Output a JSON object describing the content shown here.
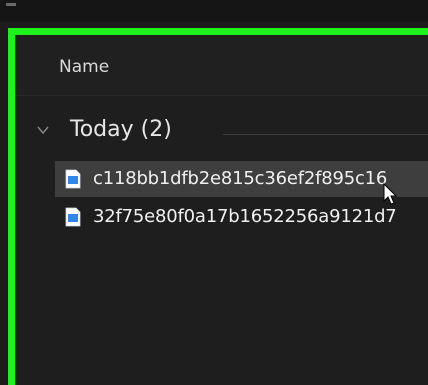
{
  "header": {
    "name_column": "Name"
  },
  "group": {
    "label": "Today (2)"
  },
  "files": [
    {
      "name": "c118bb1dfb2e815c36ef2f895c16",
      "selected": true,
      "icon": "document-icon"
    },
    {
      "name": "32f75e80f0a17b1652256a9121d7",
      "selected": false,
      "icon": "document-icon"
    }
  ],
  "colors": {
    "highlight_border": "#1ff21a",
    "selection": "#3e3e3e",
    "file_icon": "#2f86e8"
  }
}
